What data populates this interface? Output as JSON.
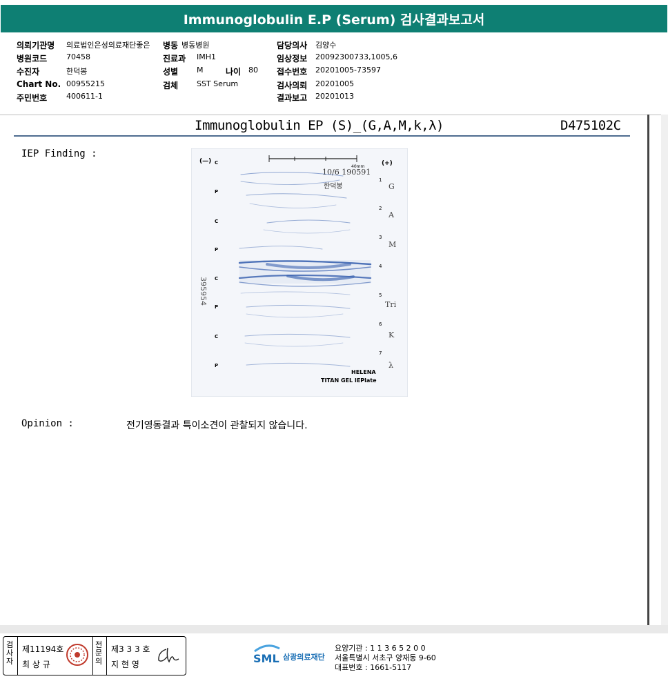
{
  "header": {
    "title": "Immunoglobulin E.P (Serum) 검사결과보고서",
    "fields": {
      "institution_label": "의뢰기관명",
      "institution": "의료법인은성의료재단좋은",
      "ward_label": "병동",
      "ward": "병동병원",
      "doctor_label": "담당의사",
      "doctor": "김양수",
      "hospital_code_label": "병원코드",
      "hospital_code": "70458",
      "dept_label": "진료과",
      "dept": "IMH1",
      "clinical_label": "임상정보",
      "clinical": "20092300733,1005,6",
      "patient_label": "수진자",
      "patient": "한덕봉",
      "sex_label": "성별",
      "sex": "M",
      "age_label": "나이",
      "age": "80",
      "receipt_label": "접수번호",
      "receipt": "20201005-73597",
      "chart_label": "Chart No.",
      "chart": "00955215",
      "specimen_label": "검체",
      "specimen": "SST Serum",
      "request_label": "검사의뢰",
      "request": "20201005",
      "resident_label": "주민번호",
      "resident": "400611-1",
      "report_label": "결과보고",
      "report": "20201013"
    }
  },
  "report": {
    "title": "Immunoglobulin EP (S)_(G,A,M,k,λ)",
    "code": "D475102C",
    "iep_label": "IEP Finding :",
    "opinion_label": "Opinion :",
    "opinion_text": "전기영동결과 특이소견이 관찰되지 않습니다."
  },
  "gel_image": {
    "left_labels": [
      "(—)",
      "C",
      "P",
      "C",
      "P",
      "C",
      "P",
      "C",
      "P"
    ],
    "right_numbers": [
      "(+)",
      "1",
      "2",
      "3",
      "4",
      "5",
      "6",
      "7"
    ],
    "right_labels": [
      "G",
      "A",
      "M",
      "Tri",
      "K",
      "λ"
    ],
    "scale_label": "40mm",
    "sample_id": "10/6 190591",
    "handwritten_name": "한덕봉",
    "side_number": "395954",
    "brand_line1": "HELENA",
    "brand_line2": "TITAN GEL IEPlate"
  },
  "footer": {
    "signer1_side": "검사자",
    "signer1_no": "제11194호",
    "signer1_name": "최 상 규",
    "signer2_side": "전문의",
    "signer2_no": "제3 3 3 호",
    "signer2_name": "지 현 영",
    "org_logo": "SML",
    "org_name": "삼광의료재단",
    "addr1": "요양기관 : 1 1 3 6 5 2 0 0",
    "addr2": "서울특별시 서초구 양재동 9-60",
    "addr3": "대표번호 : 1661-5117"
  },
  "colors": {
    "title_bar": "#0e7f73",
    "gel_band": "#2a55a8",
    "rule": "#4d6b8f"
  }
}
